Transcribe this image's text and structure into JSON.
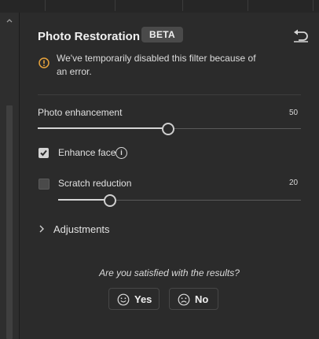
{
  "panel": {
    "title": "Photo Restoration",
    "badge": "BETA",
    "warning": "We've temporarily disabled this filter because of an error."
  },
  "controls": {
    "enhancement": {
      "label": "Photo enhancement",
      "value": "50"
    },
    "enhance_face": {
      "label": "Enhance face",
      "checked": true
    },
    "scratch": {
      "label": "Scratch reduction",
      "checked": false,
      "value": "20"
    }
  },
  "adjustments": {
    "label": "Adjustments"
  },
  "feedback": {
    "question": "Are you satisfied with the results?",
    "yes_label": "Yes",
    "no_label": "No"
  },
  "icons": {
    "reset": "undo-icon",
    "warning": "warning-circle-icon",
    "info": "info-icon",
    "smile": "smile-icon",
    "frown": "frown-icon"
  },
  "colors": {
    "background": "#2b2b2b",
    "warning": "#e8a33c",
    "text": "#e6e6e6"
  }
}
